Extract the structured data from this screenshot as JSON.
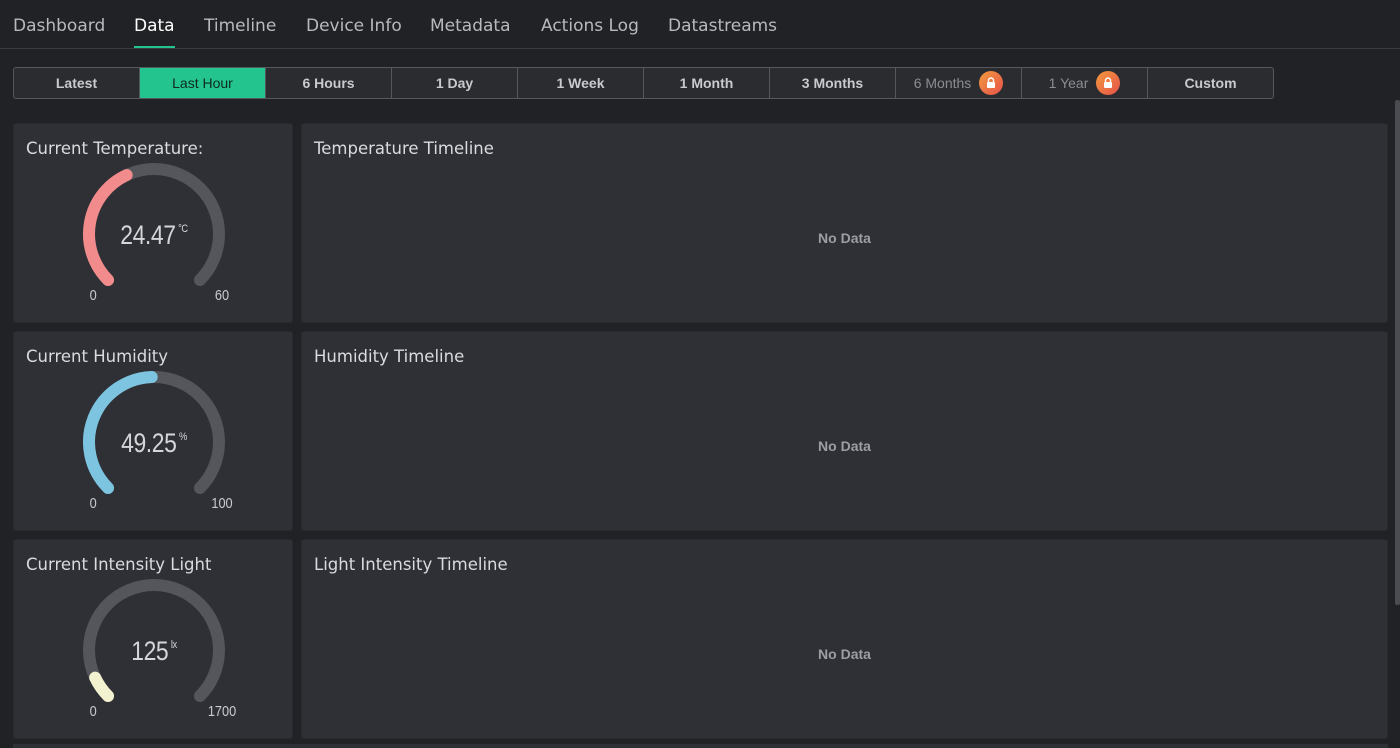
{
  "tabs": [
    {
      "label": "Dashboard",
      "active": false
    },
    {
      "label": "Data",
      "active": true
    },
    {
      "label": "Timeline",
      "active": false
    },
    {
      "label": "Device Info",
      "active": false
    },
    {
      "label": "Metadata",
      "active": false
    },
    {
      "label": "Actions Log",
      "active": false
    },
    {
      "label": "Datastreams",
      "active": false
    }
  ],
  "ranges": [
    {
      "label": "Latest"
    },
    {
      "label": "Last Hour",
      "active": true
    },
    {
      "label": "6 Hours"
    },
    {
      "label": "1 Day"
    },
    {
      "label": "1 Week"
    },
    {
      "label": "1 Month"
    },
    {
      "label": "3 Months"
    },
    {
      "label": "6 Months",
      "locked": true,
      "icon": "lock-icon"
    },
    {
      "label": "1 Year",
      "locked": true,
      "icon": "lock-icon"
    },
    {
      "label": "Custom"
    }
  ],
  "colors": {
    "accent": "#23c48e",
    "temperature": "#f28b8c",
    "humidity": "#7cc4e0",
    "light": "#f3f2d0",
    "track": "#55565c"
  },
  "widgets": [
    {
      "gauge": {
        "title": "Current Temperature:",
        "value": "24.47",
        "unit": "°C",
        "min": "0",
        "max": "60",
        "fraction": 0.408,
        "color": "#f28b8c"
      },
      "chart": {
        "title": "Temperature Timeline",
        "empty_text": "No Data"
      }
    },
    {
      "gauge": {
        "title": "Current Humidity",
        "value": "49.25",
        "unit": "%",
        "min": "0",
        "max": "100",
        "fraction": 0.4925,
        "color": "#7cc4e0"
      },
      "chart": {
        "title": "Humidity Timeline",
        "empty_text": "No Data"
      }
    },
    {
      "gauge": {
        "title": "Current Intensity Light",
        "value": "125",
        "unit": "lx",
        "min": "0",
        "max": "1700",
        "fraction": 0.0735,
        "color": "#f3f2d0"
      },
      "chart": {
        "title": "Light Intensity Timeline",
        "empty_text": "No Data"
      }
    }
  ]
}
